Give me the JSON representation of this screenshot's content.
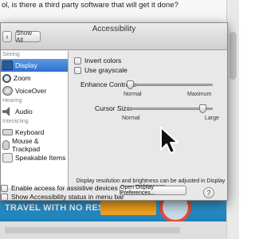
{
  "background": {
    "question_text": "ol, is there a third party software that will get it done?",
    "ad_text": "TRAVEL WITH NO RESTRICTIONS",
    "ad_button": ""
  },
  "window": {
    "title": "Accessibility",
    "show_all_label": "Show All",
    "back_label": "‹"
  },
  "sidebar": {
    "headers": [
      "Seeing",
      "Hearing",
      "Interacting"
    ],
    "items": [
      {
        "label": "Display",
        "icon": "display-icon",
        "selected": true
      },
      {
        "label": "Zoom",
        "icon": "zoom-icon"
      },
      {
        "label": "VoiceOver",
        "icon": "voiceover-icon"
      },
      {
        "label": "Audio",
        "icon": "audio-icon"
      },
      {
        "label": "Keyboard",
        "icon": "keyboard-icon"
      },
      {
        "label": "Mouse & Trackpad",
        "icon": "mouse-icon"
      },
      {
        "label": "Speakable Items",
        "icon": "speakable-icon"
      }
    ]
  },
  "display_pane": {
    "invert_colors_label": "Invert colors",
    "use_grayscale_label": "Use grayscale",
    "enhance_contrast": {
      "label": "Enhance Contrast:",
      "min_label": "Normal",
      "max_label": "Maximum",
      "value_fraction": 0.0
    },
    "cursor_size": {
      "label": "Cursor Size:",
      "min_label": "Normal",
      "max_label": "Large",
      "value_fraction": 0.92
    },
    "note": "Display resolution and brightness can be adjusted in Display preferences:",
    "open_display_prefs_label": "Open Display Preferences..."
  },
  "bottom": {
    "enable_access_label": "Enable access for assistive devices",
    "show_status_label": "Show Accessibility status in menu bar",
    "help_label": "?"
  },
  "colors": {
    "selection_blue": "#2f6fcf",
    "ad_blue": "#31a1d9",
    "ad_orange": "#f3a21f"
  }
}
